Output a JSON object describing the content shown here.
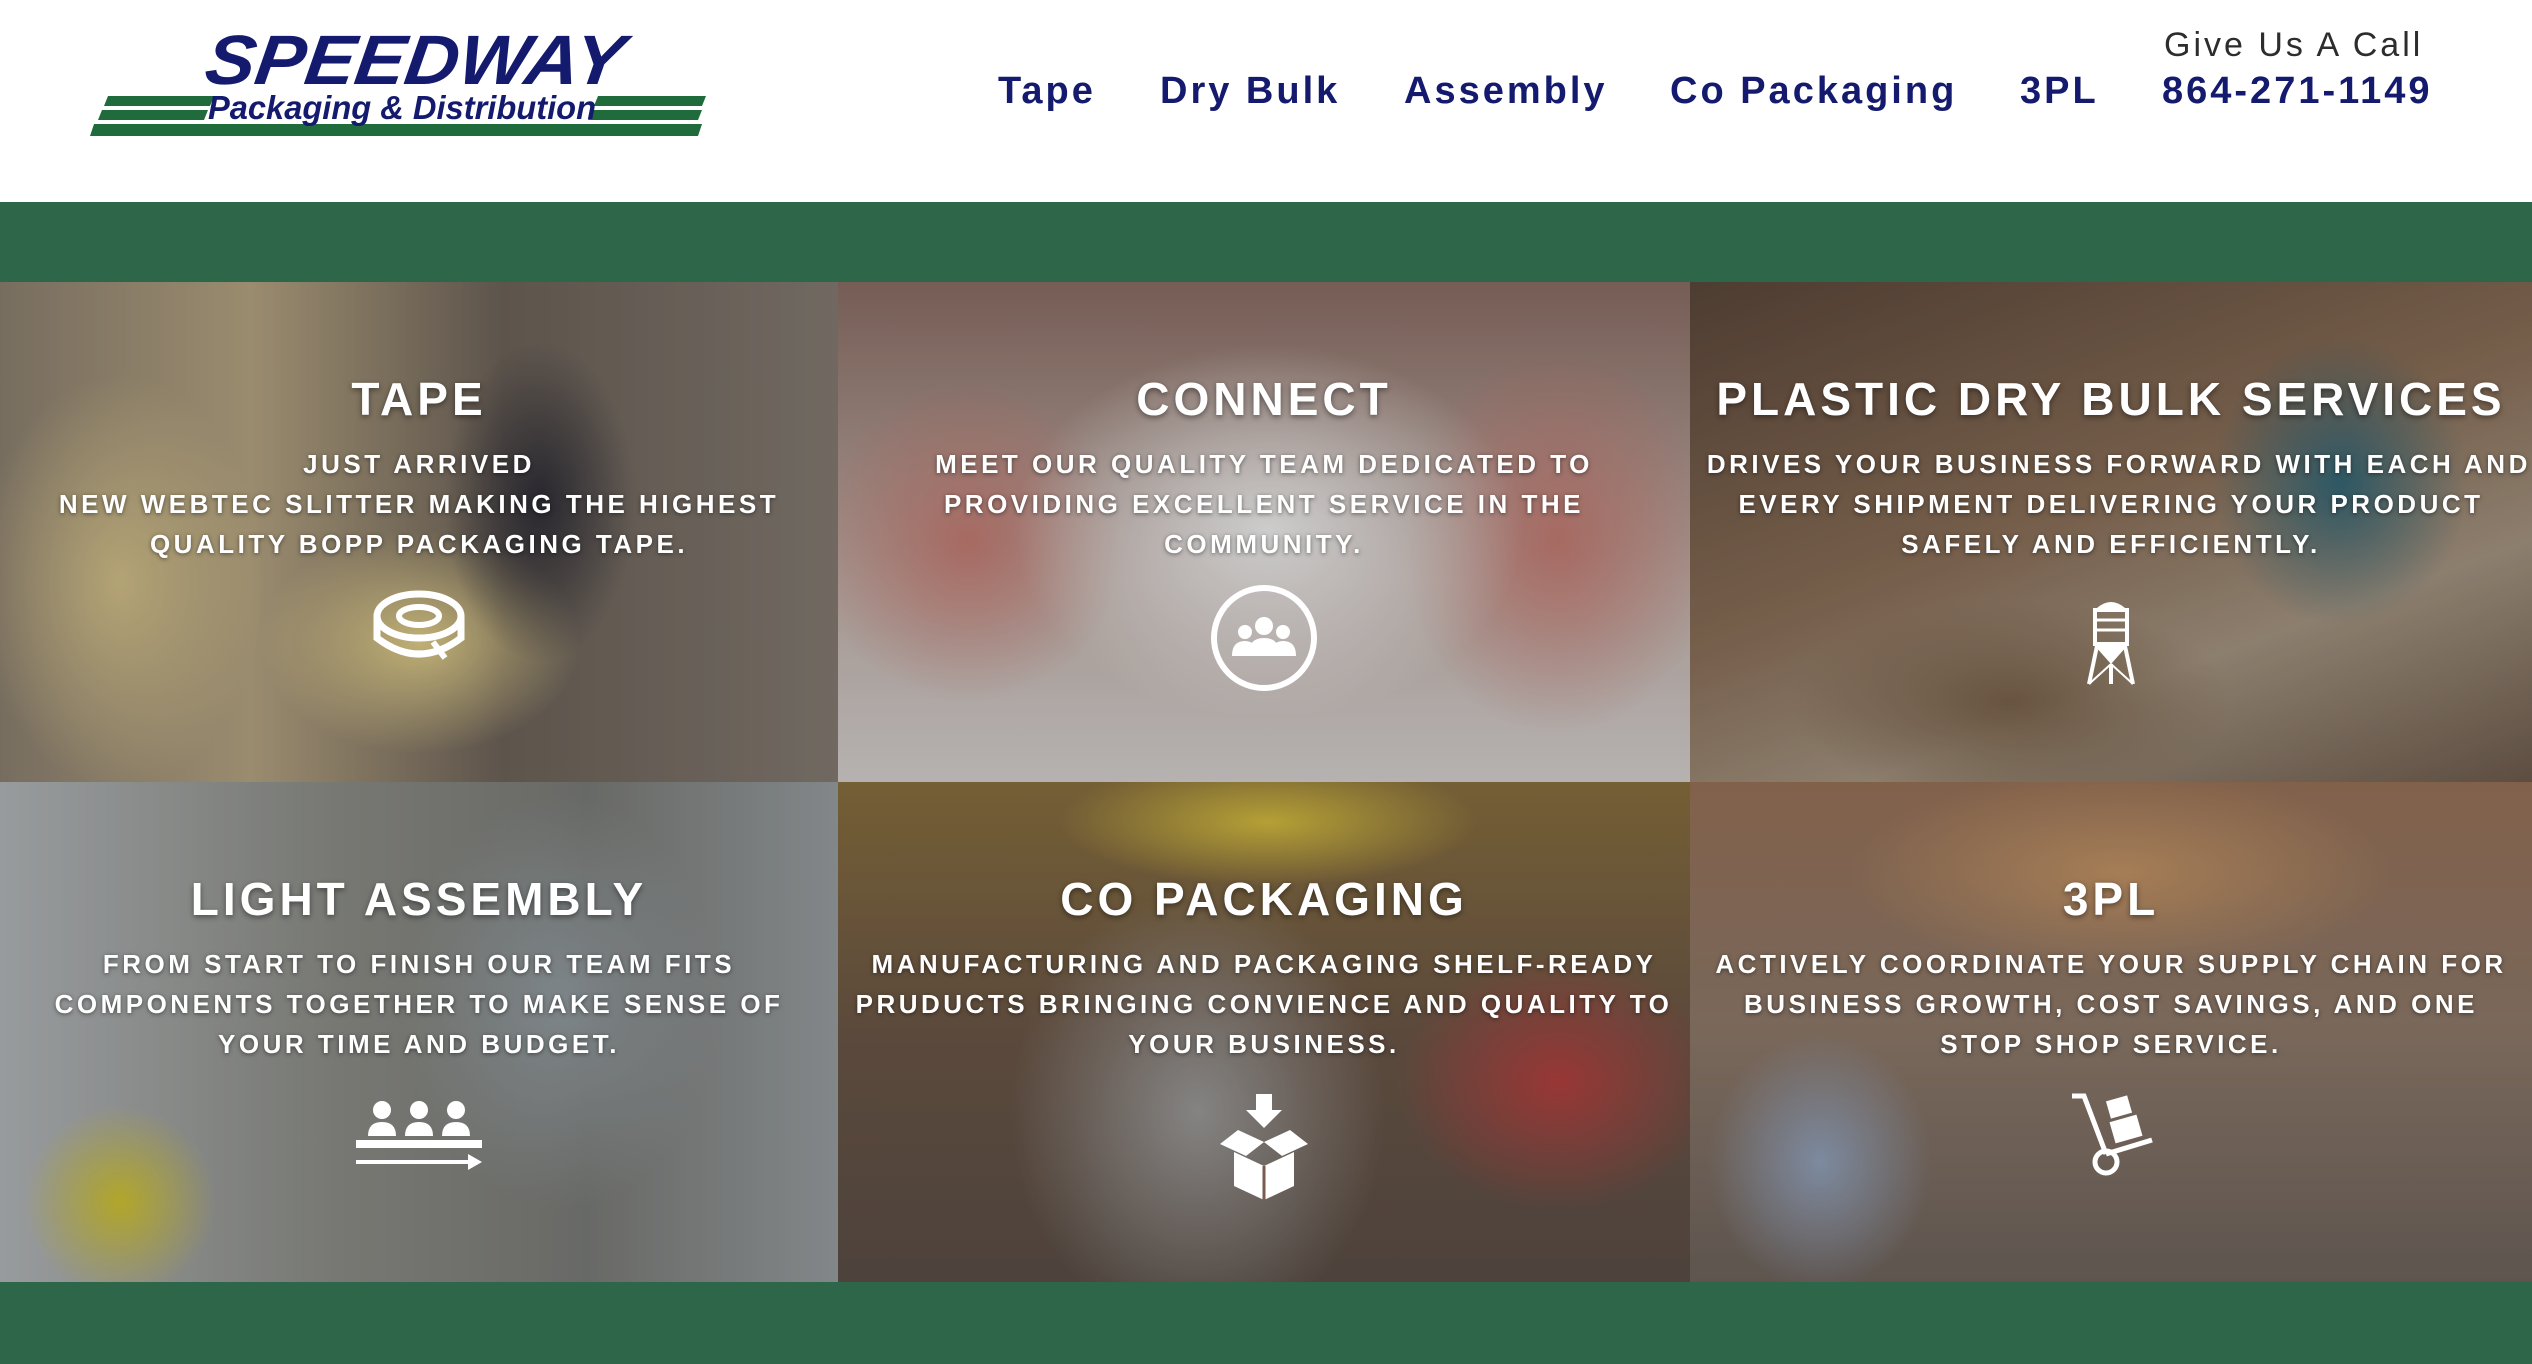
{
  "brand": {
    "name": "SPEEDWAY",
    "tagline": "Packaging & Distribution",
    "primary_color": "#141a6e",
    "accent_color": "#1f6b3b"
  },
  "nav": {
    "items": [
      {
        "label": "Tape"
      },
      {
        "label": "Dry Bulk"
      },
      {
        "label": "Assembly"
      },
      {
        "label": "Co Packaging"
      },
      {
        "label": "3PL"
      }
    ],
    "call_label": "Give Us A Call",
    "phone": "864-271-1149"
  },
  "band_color": "#2e664a",
  "tiles": [
    {
      "title": "TAPE",
      "lines": [
        "JUST ARRIVED",
        "NEW WEBTEC SLITTER MAKING THE HIGHEST",
        "QUALITY BOPP PACKAGING TAPE."
      ],
      "icon": "tape-roll-icon"
    },
    {
      "title": "CONNECT",
      "lines": [
        "MEET OUR QUALITY TEAM DEDICATED TO",
        "PROVIDING EXCELLENT SERVICE IN THE",
        "COMMUNITY."
      ],
      "icon": "team-icon"
    },
    {
      "title": "PLASTIC DRY BULK SERVICES",
      "lines": [
        "DRIVES YOUR BUSINESS FORWARD WITH EACH AND",
        "EVERY SHIPMENT DELIVERING YOUR PRODUCT",
        "SAFELY AND EFFICIENTLY."
      ],
      "icon": "silo-icon"
    },
    {
      "title": "LIGHT ASSEMBLY",
      "lines": [
        "FROM START TO FINISH OUR TEAM FITS",
        "COMPONENTS TOGETHER TO MAKE SENSE OF",
        "YOUR TIME AND BUDGET."
      ],
      "icon": "assembly-line-icon"
    },
    {
      "title": "CO PACKAGING",
      "lines": [
        "MANUFACTURING AND PACKAGING SHELF-READY",
        "PRUDUCTS BRINGING CONVIENCE AND QUALITY TO",
        "YOUR BUSINESS."
      ],
      "icon": "open-box-icon"
    },
    {
      "title": "3PL",
      "lines": [
        "ACTIVELY COORDINATE YOUR SUPPLY CHAIN FOR",
        "BUSINESS GROWTH, COST SAVINGS, AND ONE",
        "STOP SHOP SERVICE."
      ],
      "icon": "hand-truck-icon"
    }
  ]
}
